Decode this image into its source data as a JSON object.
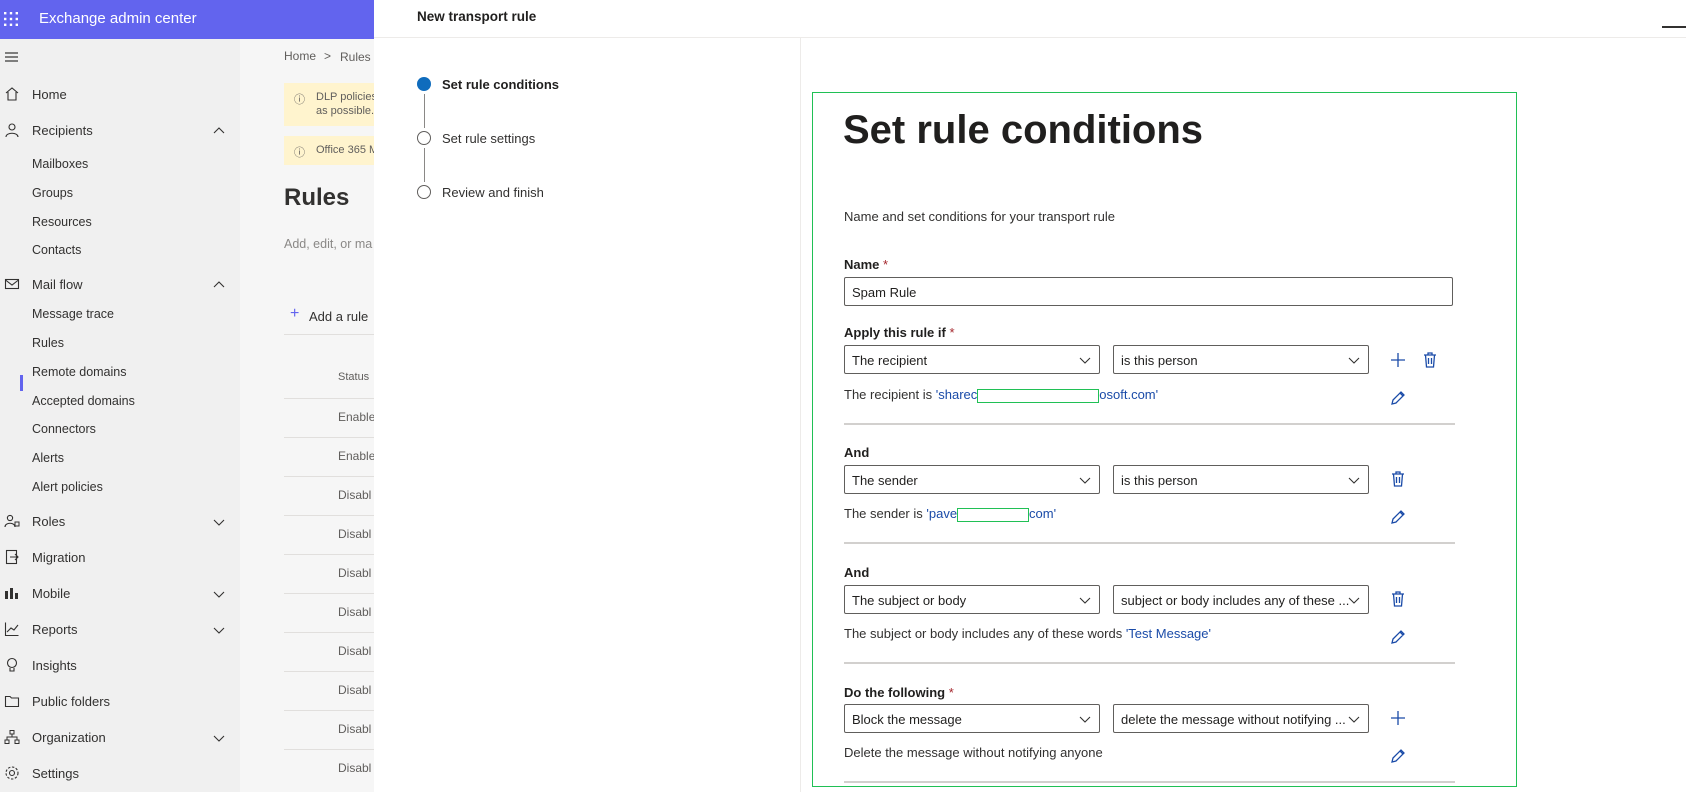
{
  "header": {
    "app_title": "Exchange admin center"
  },
  "nav": {
    "items": [
      {
        "label": "Home",
        "icon": "home-icon"
      },
      {
        "label": "Recipients",
        "icon": "person-icon"
      },
      {
        "label": "Mail flow",
        "icon": "mail-icon"
      },
      {
        "label": "Roles",
        "icon": "roles-icon"
      },
      {
        "label": "Migration",
        "icon": "migration-icon"
      },
      {
        "label": "Mobile",
        "icon": "mobile-icon"
      },
      {
        "label": "Reports",
        "icon": "chart-icon"
      },
      {
        "label": "Insights",
        "icon": "lightbulb-icon"
      },
      {
        "label": "Public folders",
        "icon": "folder-icon"
      },
      {
        "label": "Organization",
        "icon": "organization-icon"
      },
      {
        "label": "Settings",
        "icon": "gear-icon"
      }
    ],
    "recipients_sub": [
      "Mailboxes",
      "Groups",
      "Resources",
      "Contacts"
    ],
    "mailflow_sub": [
      "Message trace",
      "Rules",
      "Remote domains",
      "Accepted domains",
      "Connectors",
      "Alerts",
      "Alert policies"
    ]
  },
  "background_page": {
    "breadcrumb_home": "Home",
    "breadcrumb_rules": "Rules",
    "banner1_line1": "DLP policies",
    "banner1_line2": "as possible.",
    "banner2": "Office 365 M",
    "title": "Rules",
    "subtitle": "Add, edit, or ma",
    "add_rule": "Add a rule",
    "status_header": "Status",
    "rows": [
      "Enable",
      "Enable",
      "Disabl",
      "Disabl",
      "Disabl",
      "Disabl",
      "Disabl",
      "Disabl",
      "Disabl",
      "Disabl"
    ]
  },
  "panel": {
    "title": "New transport rule",
    "steps": [
      {
        "label": "Set rule conditions",
        "state": "current"
      },
      {
        "label": "Set rule settings",
        "state": "pending"
      },
      {
        "label": "Review and finish",
        "state": "pending"
      }
    ],
    "heading": "Set rule conditions",
    "description": "Name and set conditions for your transport rule",
    "name_label": "Name",
    "required_mark": "*",
    "name_value": "Spam Rule",
    "apply_label": "Apply this rule if",
    "and_label": "And",
    "do_label": "Do the following",
    "conditions": [
      {
        "field": "The recipient",
        "operator": "is this person",
        "summary_prefix": "The recipient is ",
        "summary_value_start": "'sharec",
        "summary_value_end": "osoft.com'"
      },
      {
        "field": "The sender",
        "operator": "is this person",
        "summary_prefix": "The sender is ",
        "summary_value_start": "'pave",
        "summary_value_end": "com'"
      },
      {
        "field": "The subject or body",
        "operator": "subject or body includes any of these ...",
        "summary_prefix": "The subject or body includes any of these words ",
        "summary_value_start": "'Test Message'",
        "summary_value_end": ""
      }
    ],
    "action": {
      "field": "Block the message",
      "operator": "delete the message without notifying ...",
      "summary": "Delete the message without notifying anyone"
    },
    "colors": {
      "accent": "#6264ee",
      "step_current": "#0f6cbd",
      "link": "#1a4ba8",
      "outline": "#20c055"
    }
  }
}
